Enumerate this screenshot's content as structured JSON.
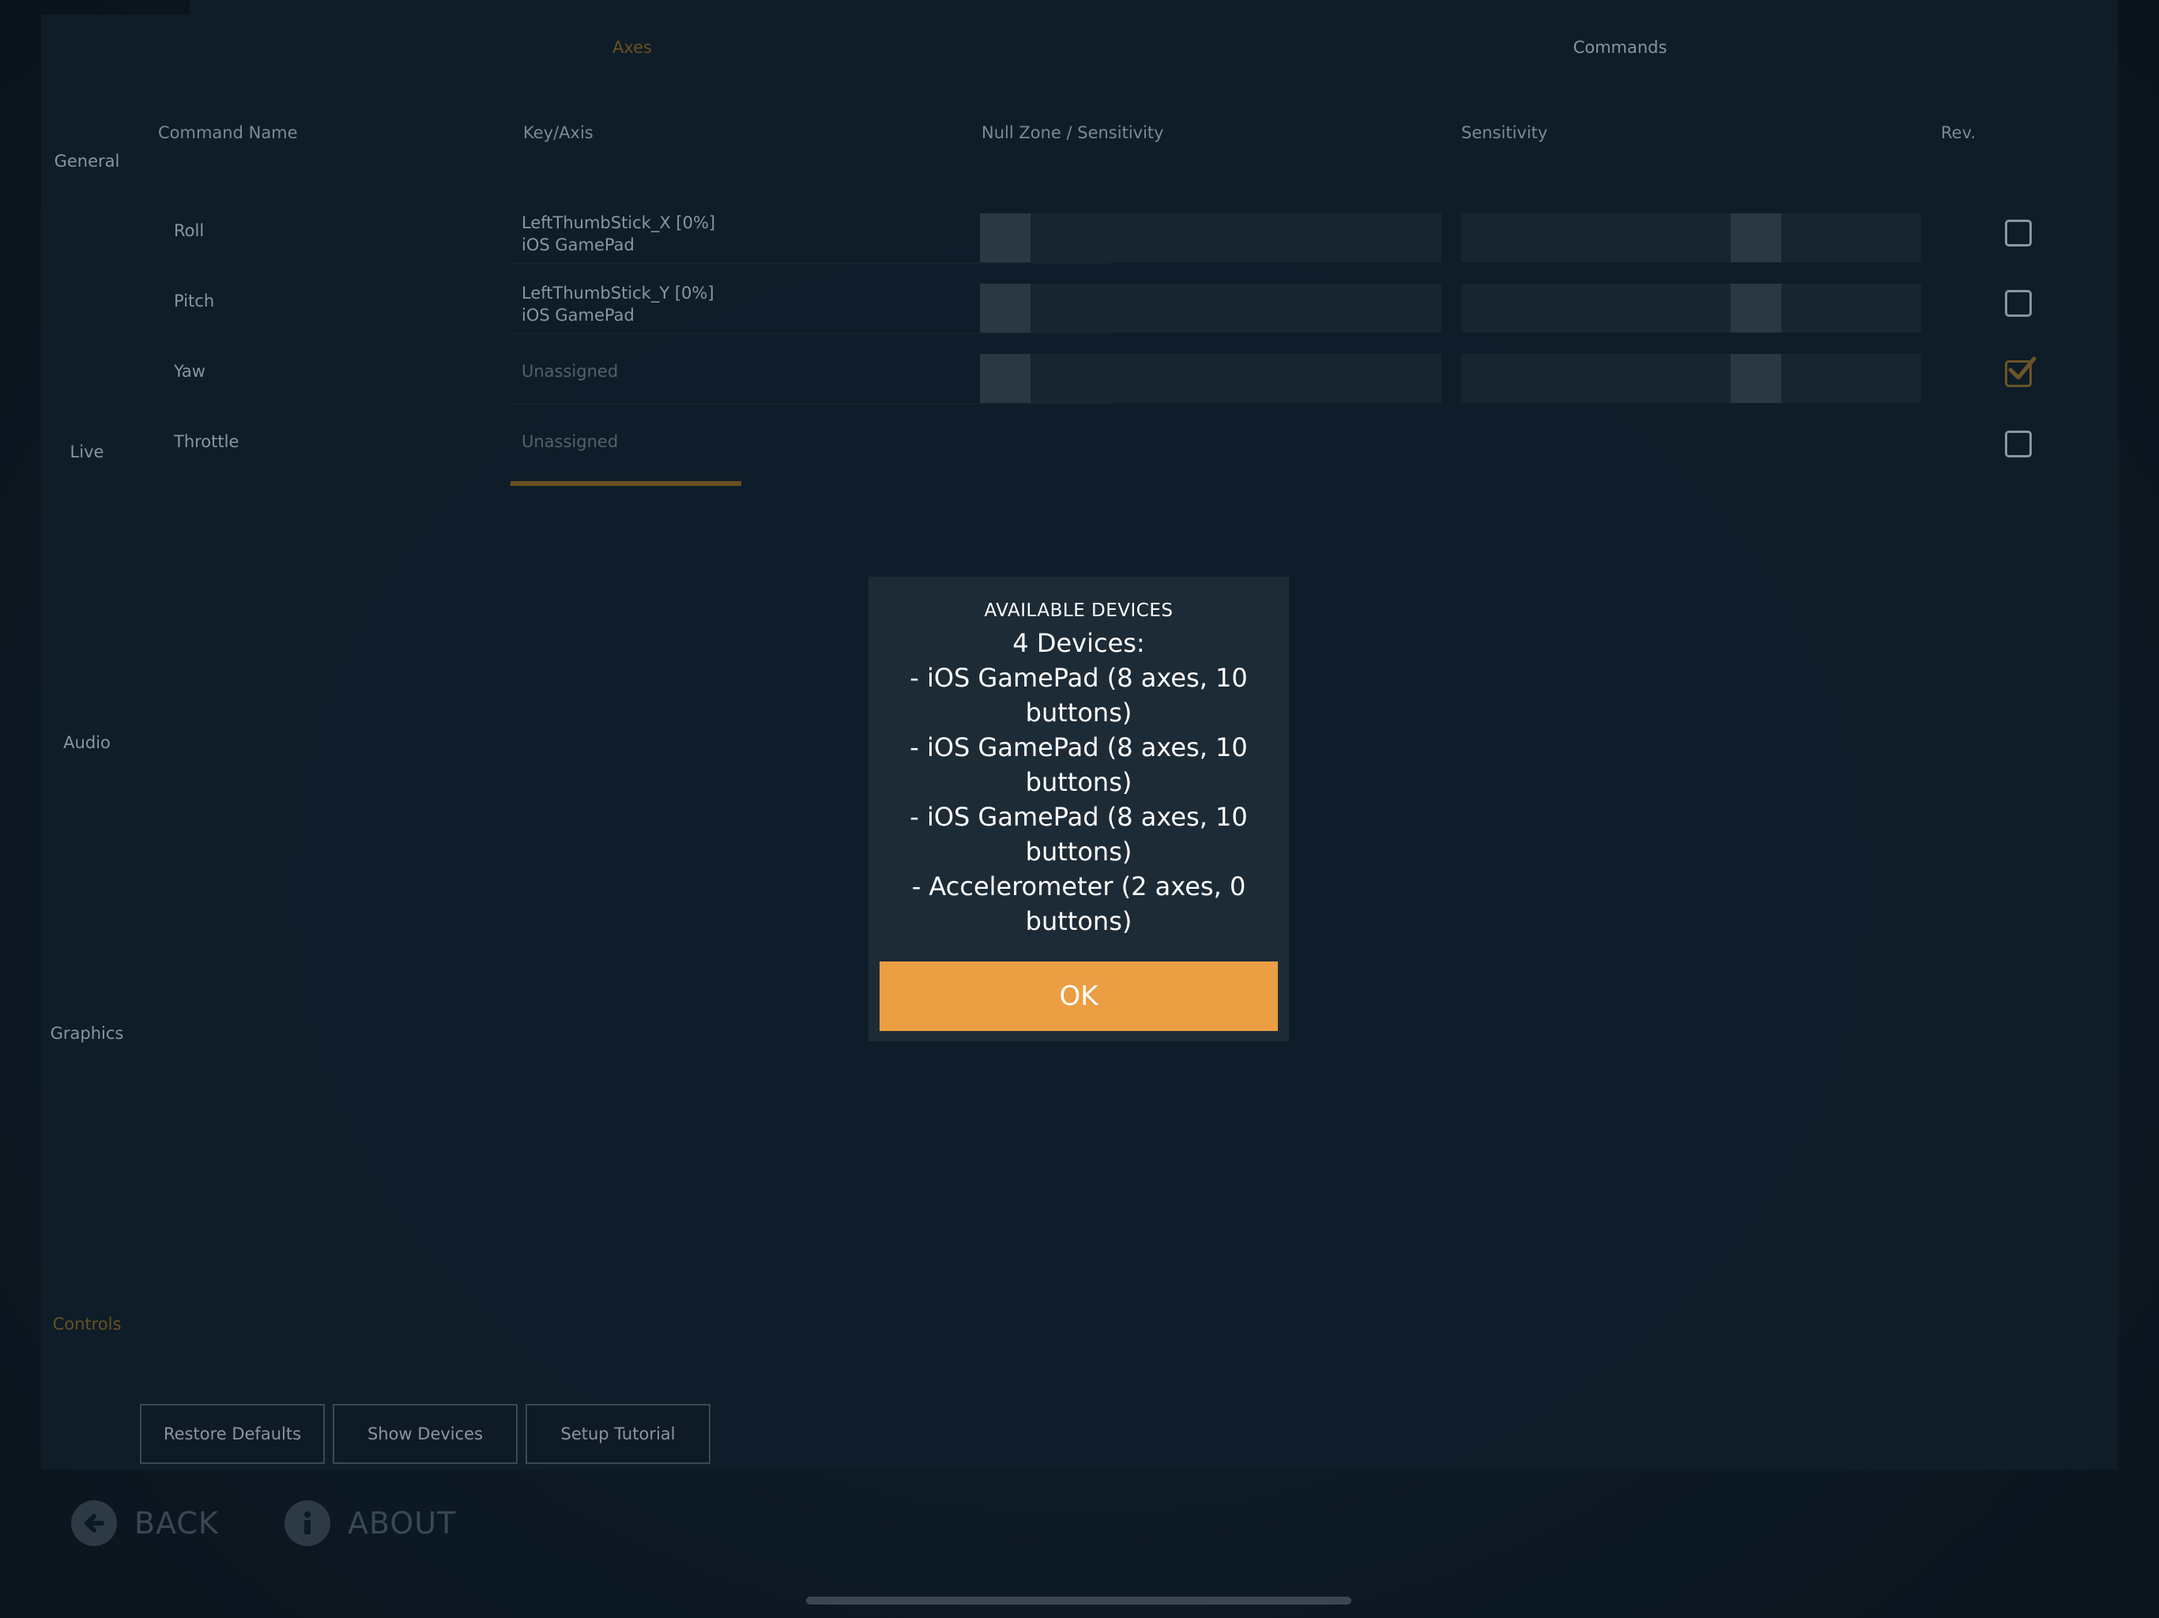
{
  "tabs": [
    {
      "label": "Axes",
      "active": true
    },
    {
      "label": "Commands",
      "active": false
    }
  ],
  "nav": [
    {
      "label": "General",
      "active": false
    },
    {
      "label": "Live",
      "active": false
    },
    {
      "label": "Audio",
      "active": false
    },
    {
      "label": "Graphics",
      "active": false
    },
    {
      "label": "Controls",
      "active": true
    }
  ],
  "table": {
    "headers": {
      "command_name": "Command Name",
      "key_axis": "Key/Axis",
      "null_zone": "Null Zone / Sensitivity",
      "sensitivity": "Sensitivity",
      "rev": "Rev."
    },
    "rows": [
      {
        "name": "Roll",
        "key": "LeftThumbStick_X [0%]",
        "device": "iOS GamePad",
        "reversed": false
      },
      {
        "name": "Pitch",
        "key": "LeftThumbStick_Y [0%]",
        "device": "iOS GamePad",
        "reversed": false
      },
      {
        "name": "Yaw",
        "key": "Unassigned",
        "device": "",
        "reversed": true
      },
      {
        "name": "Throttle",
        "key": "Unassigned",
        "device": "",
        "reversed": false
      }
    ]
  },
  "buttons": {
    "restore_defaults": "Restore Defaults",
    "show_devices": "Show Devices",
    "setup_tutorial": "Setup Tutorial"
  },
  "footer": {
    "back": "BACK",
    "about": "ABOUT"
  },
  "modal": {
    "title": "AVAILABLE DEVICES",
    "lines": [
      "4 Devices:",
      "- iOS GamePad (8 axes, 10 buttons)",
      "- iOS GamePad (8 axes, 10 buttons)",
      "- iOS GamePad (8 axes, 10 buttons)",
      "- Accelerometer (2 axes, 0 buttons)"
    ],
    "ok_label": "OK"
  },
  "colors": {
    "accent": "#eb9e42",
    "active_dim": "#6b5020",
    "background": "#0c1822",
    "modal_bg": "#1d2b37"
  }
}
